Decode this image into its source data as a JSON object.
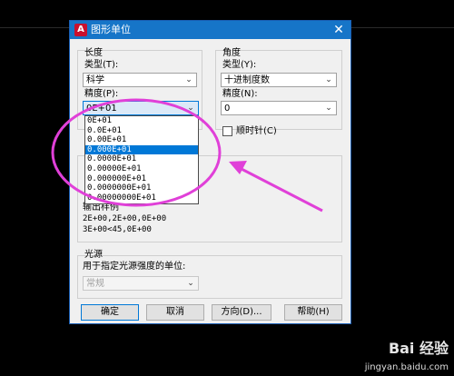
{
  "dialog": {
    "title": "图形单位",
    "close_glyph": "✕",
    "app_icon_glyph": "A"
  },
  "length": {
    "group_label": "长度",
    "type_label": "类型(T):",
    "type_value": "科学",
    "precision_label": "精度(P):",
    "precision_value": "0E+01",
    "precision_options": [
      "0E+01",
      "0.0E+01",
      "0.00E+01",
      "0.000E+01",
      "0.0000E+01",
      "0.00000E+01",
      "0.000000E+01",
      "0.0000000E+01",
      "0.00000000E+01"
    ],
    "selected_index": 3
  },
  "angle": {
    "group_label": "角度",
    "type_label": "类型(Y):",
    "type_value": "十进制度数",
    "precision_label": "精度(N):",
    "precision_value": "0",
    "clockwise_label": "顺时针(C)"
  },
  "output": {
    "group_label": "输出样例",
    "line1": "2E+00,2E+00,0E+00",
    "line2": "3E+00<45,0E+00"
  },
  "light": {
    "group_label": "光源",
    "units_label": "用于指定光源强度的单位:",
    "units_value": "常规"
  },
  "buttons": {
    "ok": "确定",
    "cancel": "取消",
    "direction": "方向(D)...",
    "help": "帮助(H)"
  },
  "watermark": {
    "brand": "Bai 经验",
    "url": "jingyan.baidu.com"
  },
  "colors": {
    "annotation": "#e040d8",
    "accent": "#0078d7",
    "titlebar": "#1675c8"
  }
}
